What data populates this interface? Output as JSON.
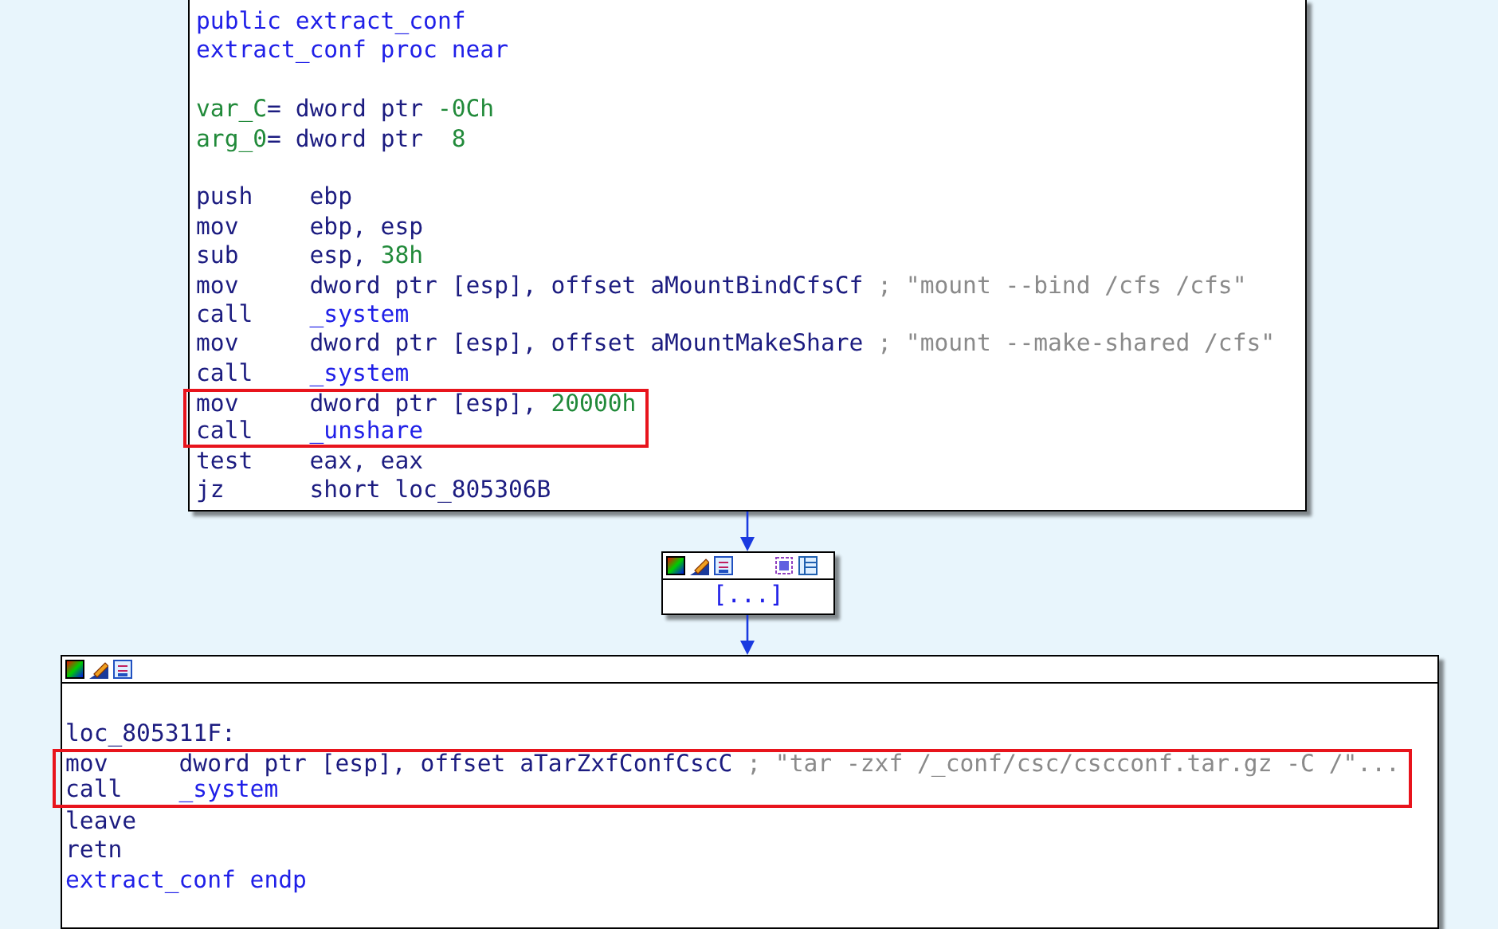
{
  "blocks": [
    {
      "kind": "code",
      "header": false,
      "lines": [
        {
          "kind": "code",
          "highlighted": false,
          "parts": [
            {
              "text": "public extract_conf",
              "kind": "label"
            }
          ]
        },
        {
          "kind": "code",
          "highlighted": false,
          "parts": [
            {
              "text": "extract_conf proc near",
              "kind": "label"
            }
          ]
        },
        {
          "kind": "blank"
        },
        {
          "kind": "code",
          "highlighted": false,
          "parts": [
            {
              "text": "var_C",
              "kind": "var"
            },
            {
              "text": "= dword ptr ",
              "kind": "operand"
            },
            {
              "text": "-0Ch",
              "kind": "number"
            }
          ]
        },
        {
          "kind": "code",
          "highlighted": false,
          "parts": [
            {
              "text": "arg_0",
              "kind": "var"
            },
            {
              "text": "= dword ptr  ",
              "kind": "operand"
            },
            {
              "text": "8",
              "kind": "number"
            }
          ]
        },
        {
          "kind": "blank"
        },
        {
          "kind": "code",
          "highlighted": false,
          "parts": [
            {
              "text": "push",
              "kind": "mnemonic"
            },
            {
              "text": "ebp",
              "kind": "operand"
            }
          ]
        },
        {
          "kind": "code",
          "highlighted": false,
          "parts": [
            {
              "text": "mov",
              "kind": "mnemonic"
            },
            {
              "text": "ebp, esp",
              "kind": "operand"
            }
          ]
        },
        {
          "kind": "code",
          "highlighted": false,
          "parts": [
            {
              "text": "sub",
              "kind": "mnemonic"
            },
            {
              "text": "esp, ",
              "kind": "operand"
            },
            {
              "text": "38h",
              "kind": "number"
            }
          ]
        },
        {
          "kind": "code",
          "highlighted": false,
          "parts": [
            {
              "text": "mov",
              "kind": "mnemonic"
            },
            {
              "text": "dword ptr [esp], offset aMountBindCfsCf",
              "kind": "operand"
            },
            {
              "text": " ; \"mount --bind /cfs /cfs\"",
              "kind": "comment"
            }
          ]
        },
        {
          "kind": "code",
          "highlighted": false,
          "parts": [
            {
              "text": "call",
              "kind": "mnemonic"
            },
            {
              "text": "_system",
              "kind": "label"
            }
          ]
        },
        {
          "kind": "code",
          "highlighted": false,
          "parts": [
            {
              "text": "mov",
              "kind": "mnemonic"
            },
            {
              "text": "dword ptr [esp], offset aMountMakeShare",
              "kind": "operand"
            },
            {
              "text": " ; \"mount --make-shared /cfs\"",
              "kind": "comment"
            }
          ]
        },
        {
          "kind": "code",
          "highlighted": false,
          "parts": [
            {
              "text": "call",
              "kind": "mnemonic"
            },
            {
              "text": "_system",
              "kind": "label"
            }
          ]
        },
        {
          "kind": "code",
          "highlighted": true,
          "parts": [
            {
              "text": "mov",
              "kind": "mnemonic"
            },
            {
              "text": "dword ptr [esp], ",
              "kind": "operand"
            },
            {
              "text": "20000h",
              "kind": "number"
            }
          ]
        },
        {
          "kind": "code",
          "highlighted": true,
          "parts": [
            {
              "text": "call",
              "kind": "mnemonic"
            },
            {
              "text": "_unshare",
              "kind": "label"
            }
          ]
        },
        {
          "kind": "code",
          "highlighted": false,
          "parts": [
            {
              "text": "test",
              "kind": "mnemonic"
            },
            {
              "text": "eax, eax",
              "kind": "operand"
            }
          ]
        },
        {
          "kind": "code",
          "highlighted": false,
          "parts": [
            {
              "text": "jz",
              "kind": "mnemonic"
            },
            {
              "text": "short loc_805306B",
              "kind": "operand"
            }
          ]
        }
      ]
    },
    {
      "kind": "collapsed",
      "header": true,
      "text": "[...]"
    },
    {
      "kind": "code",
      "header": true,
      "lines": [
        {
          "kind": "blank"
        },
        {
          "kind": "code",
          "highlighted": false,
          "parts": [
            {
              "text": "loc_805311F:",
              "kind": "operand"
            }
          ]
        },
        {
          "kind": "code",
          "highlighted": true,
          "parts": [
            {
              "text": "mov",
              "kind": "mnemonic"
            },
            {
              "text": "dword ptr [esp], offset aTarZxfConfCscC",
              "kind": "operand"
            },
            {
              "text": " ; \"tar -zxf /_conf/csc/cscconf.tar.gz -C /\"...",
              "kind": "comment"
            }
          ]
        },
        {
          "kind": "code",
          "highlighted": true,
          "parts": [
            {
              "text": "call",
              "kind": "mnemonic"
            },
            {
              "text": "_system",
              "kind": "label"
            }
          ]
        },
        {
          "kind": "code",
          "highlighted": false,
          "parts": [
            {
              "text": "leave",
              "kind": "mnemonic"
            }
          ]
        },
        {
          "kind": "code",
          "highlighted": false,
          "parts": [
            {
              "text": "retn",
              "kind": "mnemonic"
            }
          ]
        },
        {
          "kind": "code",
          "highlighted": false,
          "parts": [
            {
              "text": "extract_conf endp",
              "kind": "label"
            }
          ]
        }
      ]
    }
  ]
}
